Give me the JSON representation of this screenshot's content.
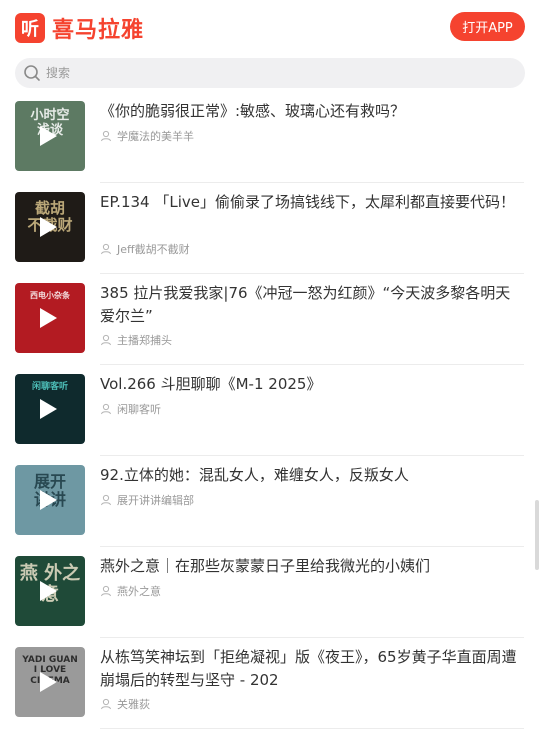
{
  "header": {
    "logo_glyph": "听",
    "logo_text": "喜马拉雅",
    "open_app": "打开APP"
  },
  "search": {
    "placeholder": "搜索"
  },
  "colors": {
    "brand": "#f5432f",
    "title": "#333333",
    "meta": "#999999",
    "search_bg": "#f0f0f2"
  },
  "items": [
    {
      "title": "《你的脆弱很正常》:敏感、玻璃心还有救吗？",
      "author": "学魔法的美羊羊",
      "cover_text": "小时空\n浅谈",
      "cover_bg": "#5d7a63",
      "cover_fg": "#ffffff"
    },
    {
      "title": "EP.134 「Live」偷偷录了场搞钱线下，太犀利都直接要代码！",
      "author": "Jeff截胡不截财",
      "cover_text": "截胡\n不截财",
      "cover_bg": "#1f1b17",
      "cover_fg": "#d6c08a"
    },
    {
      "title": "385 拉片我爱我家|76《冲冠一怒为红颜》“今天波多黎各明天爱尔兰”",
      "author": "主播郑捕头",
      "cover_text": "西电小杂条",
      "cover_bg": "#b31b22",
      "cover_fg": "#ffffff"
    },
    {
      "title": "Vol.266 斗胆聊聊《M-1 2025》",
      "author": "闲聊客听",
      "cover_text": "闲聊客听",
      "cover_bg": "#0f2a2d",
      "cover_fg": "#57d6cf"
    },
    {
      "title": "92.立体的她：混乱女人，难缠女人，反叛女人",
      "author": "展开讲讲编辑部",
      "cover_text": "展开\n讲讲",
      "cover_bg": "#6e98a3",
      "cover_fg": "#1d3a44"
    },
    {
      "title": "燕外之意｜在那些灰蒙蒙日子里给我微光的小姨们",
      "author": "燕外之意",
      "cover_text": "燕 外之意",
      "cover_bg": "#1f4a38",
      "cover_fg": "#e8e1c9"
    },
    {
      "title": "从栋笃笑神坛到「拒绝凝视」版《夜王》，65岁黄子华直面周遭崩塌后的转型与坚守 - 202",
      "author": "关雅荻",
      "cover_text": "YADI GUAN\nI LOVE\nCINEMA",
      "cover_bg": "#9a9a9a",
      "cover_fg": "#1a1a1a"
    }
  ]
}
